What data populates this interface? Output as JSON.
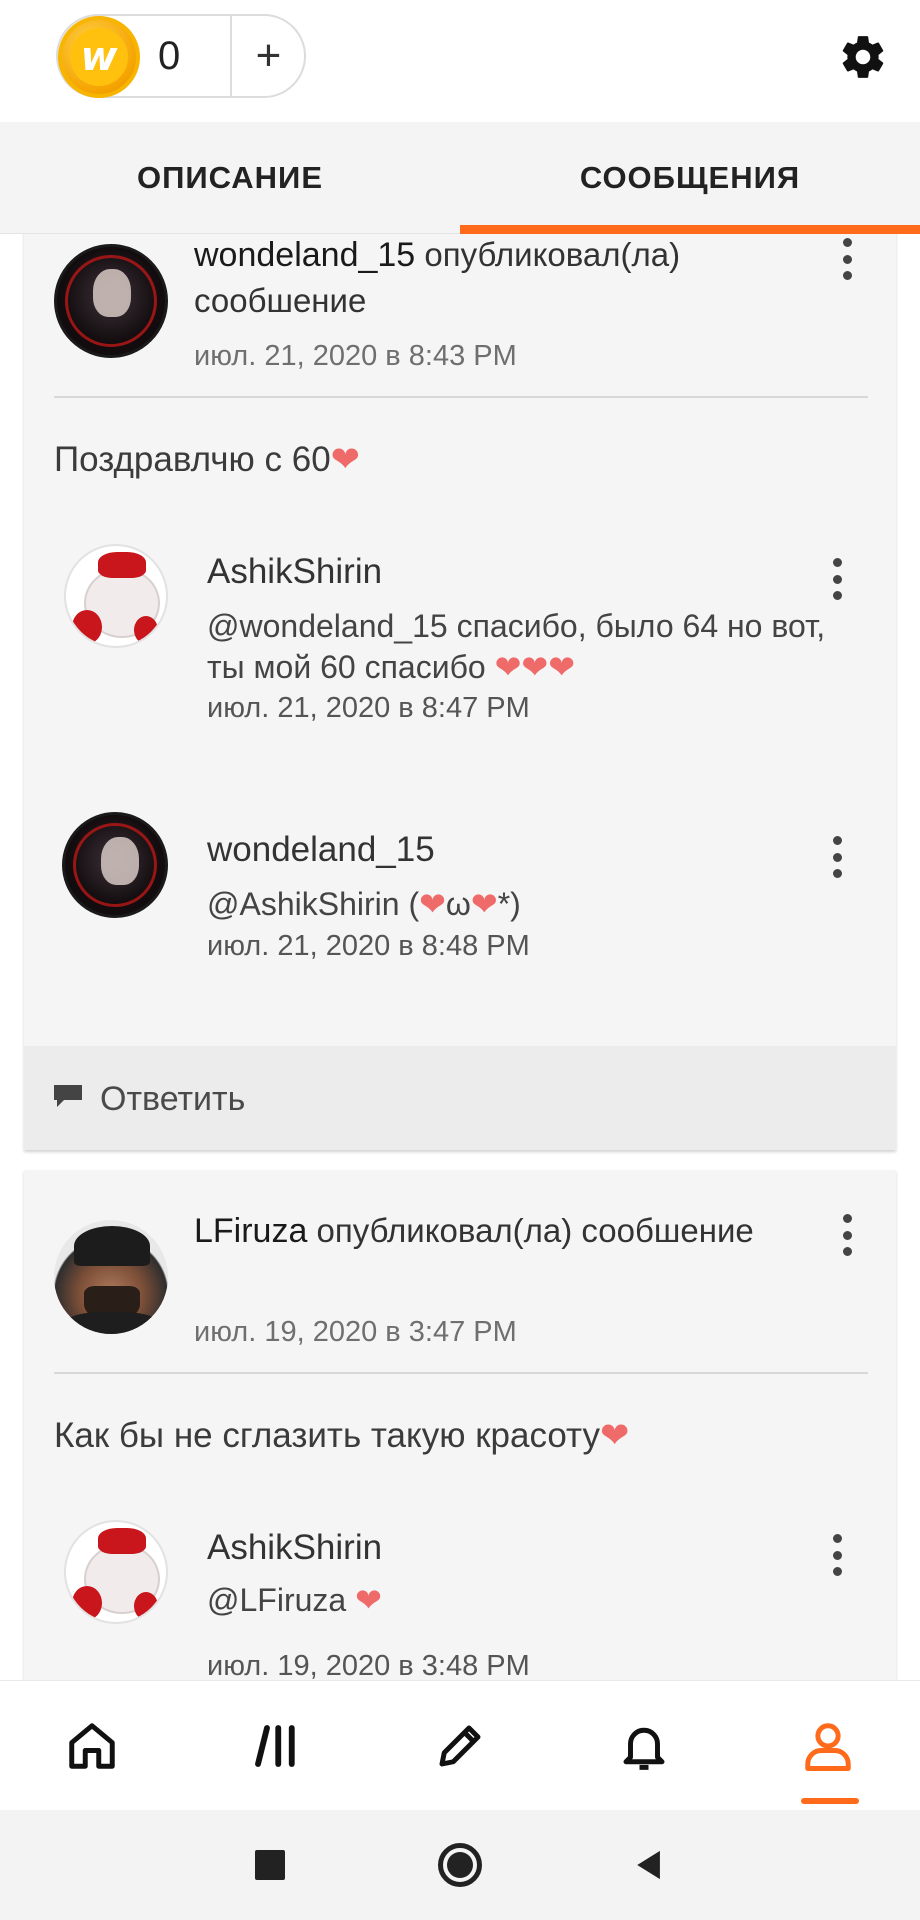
{
  "coins": {
    "count": "0",
    "plus": "+"
  },
  "tabs": {
    "description": "ОПИСАНИЕ",
    "messages": "СООБЩЕНИЯ"
  },
  "posts": [
    {
      "author": "wondeland_15",
      "action": " опубликовал(ла) сообшение",
      "time": "июл. 21, 2020 в 8:43 PM",
      "body": "Поздравлчю с 60",
      "body_heart": "❤",
      "replies": [
        {
          "author": "AshikShirin",
          "text": "@wondeland_15  спасибо, было 64 но вот, ты мой 60 спасибо ",
          "hearts": "❤❤❤",
          "time": "июл. 21, 2020 в 8:47 PM"
        },
        {
          "author": "wondeland_15",
          "text_a": "@AshikShirin  (",
          "heart_a": "❤",
          "text_b": "ω",
          "heart_b": "❤",
          "text_c": "*)",
          "time": "июл. 21, 2020 в 8:48 PM"
        }
      ],
      "reply_label": "Ответить"
    },
    {
      "author": "LFiruza",
      "action": " опубликовал(ла) сообшение",
      "time": "июл. 19, 2020 в 3:47 PM",
      "body": "Как бы не сглазить такую красоту",
      "body_heart": "❤",
      "replies": [
        {
          "author": "AshikShirin",
          "text": "@LFiruza  ",
          "hearts": "❤",
          "time": "июл. 19, 2020 в 3:48 PM"
        }
      ]
    }
  ],
  "bottom_nav": {
    "active": "profile",
    "accent": "#ff6a1b",
    "items": [
      "home-icon",
      "library-icon",
      "write-icon",
      "notifications-icon",
      "profile-icon"
    ]
  },
  "colors": {
    "accent": "#ff6a1b",
    "heart": "#ee6b69",
    "coin": "#ffc10e"
  }
}
